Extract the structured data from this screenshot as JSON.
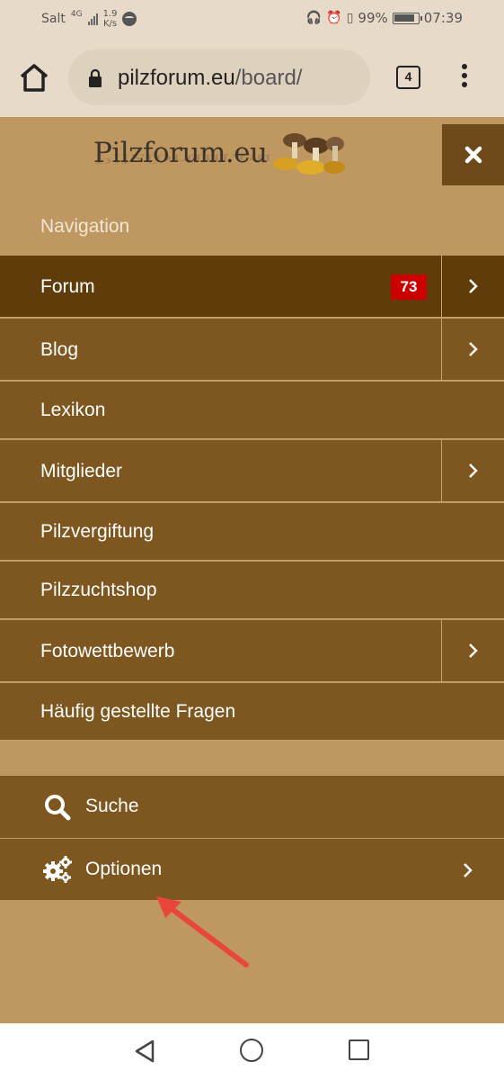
{
  "status_bar": {
    "carrier": "Salt",
    "network": "4G",
    "speed_value": "1.9",
    "speed_unit": "K/s",
    "battery": "99%",
    "time": "07:39"
  },
  "browser": {
    "url_domain": "pilzforum.eu",
    "url_path": "/board/",
    "tab_count": "4"
  },
  "site": {
    "logo_text": "Pilzforum.eu"
  },
  "navigation": {
    "heading": "Navigation",
    "items": [
      {
        "label": "Forum",
        "badge": "73",
        "has_submenu": true,
        "active": true
      },
      {
        "label": "Blog",
        "has_submenu": true
      },
      {
        "label": "Lexikon",
        "has_submenu": false
      },
      {
        "label": "Mitglieder",
        "has_submenu": true
      },
      {
        "label": "Pilzvergiftung",
        "has_submenu": false
      },
      {
        "label": "Pilzzuchtshop",
        "has_submenu": false
      },
      {
        "label": "Fotowettbewerb",
        "has_submenu": true
      },
      {
        "label": "Häufig gestellte Fragen",
        "has_submenu": false
      }
    ]
  },
  "utility": {
    "search_label": "Suche",
    "options_label": "Optionen"
  },
  "colors": {
    "page_bg": "#bf9760",
    "menu_bg": "#7e561f",
    "menu_active_bg": "#613c0b",
    "badge": "#cc0000",
    "annotation_arrow": "#e8453c"
  },
  "icons": {
    "home": "home-icon",
    "lock": "lock-icon",
    "close": "close-icon",
    "chevron": "chevron-right-icon",
    "search": "search-icon",
    "options": "gears-icon"
  }
}
